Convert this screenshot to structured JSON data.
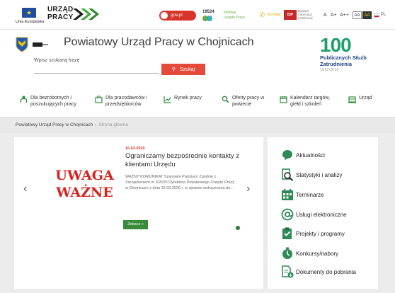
{
  "topbar": {
    "eu_label": "Unia Europejska",
    "urzad_line1": "URZĄD",
    "urzad_line2": "PRACY",
    "gov_label": "gov.pl",
    "contact_number": "19524",
    "contact_text_line1": "Infolinia",
    "contact_text_line2": "Urzędu Pracy",
    "contact_label": "Kontakt",
    "bip_label": "BIP",
    "bip_text": [
      "Biuletyn",
      "Informacji",
      "Publicznej"
    ],
    "font_sizes": [
      "A",
      "A+",
      "A++"
    ],
    "contrast": [
      "AA",
      "AA"
    ],
    "language": "PL"
  },
  "header": {
    "title": "Powiatowy Urząd Pracy w Chojnicach",
    "search_label": "Wpisz szukaną frazę",
    "search_placeholder": "",
    "search_button": "Szukaj",
    "anniversary": {
      "number": "100",
      "line1": "Publicznych Służb",
      "line2": "Zatrudnienia",
      "years": "1919-2019"
    }
  },
  "nav": {
    "items": [
      {
        "label_line1": "Dla bezrobotnych i",
        "label_line2": "poszukujących pracy",
        "icon": "person-icon"
      },
      {
        "label_line1": "Dla pracodawców i",
        "label_line2": "przedsiębiorców",
        "icon": "briefcase-icon"
      },
      {
        "label_line1": "Rynek pracy",
        "label_line2": "",
        "icon": "chart-icon"
      },
      {
        "label_line1": "Oferty pracy w",
        "label_line2": "powiecie",
        "icon": "search-icon"
      },
      {
        "label_line1": "Kalendarz targów,",
        "label_line2": "giełd i szkoleń",
        "icon": "calendar-icon"
      },
      {
        "label_line1": "Urząd",
        "label_line2": "",
        "icon": "building-icon"
      }
    ]
  },
  "breadcrumb": {
    "home": "Powiatowy Urząd Pracy w Chojnicach",
    "separator": "›",
    "current": "Strona główna"
  },
  "slider": {
    "image_text_line1": "UWAGA",
    "image_text_line2": "WAŻNE",
    "date": "16.03.2020",
    "title": "Ograniczamy bezpośrednie kontakty z klientami Urzędu",
    "body": "WAŻNY KOMUNIKAT Szanowni Państwo! Zgodnie z Zarządzeniem nr 3/2020 Dyrektora Powiatowego Urzędu Pracy w Chojnicach z dnia 16.03.2020 r. w sprawie wstrzymania do...",
    "more_button": "Zobacz »",
    "prev": "‹",
    "next": "›"
  },
  "quick_links": [
    {
      "label": "Aktualności",
      "icon": "news-icon"
    },
    {
      "label": "Statystyki i analizy",
      "icon": "statistics-icon"
    },
    {
      "label": "Terminarze",
      "icon": "calendar-icon"
    },
    {
      "label": "Usługi elektroniczne",
      "icon": "at-icon"
    },
    {
      "label": "Projekty i programy",
      "icon": "clipboard-icon"
    },
    {
      "label": "Konkursy/nabory",
      "icon": "timer-icon"
    },
    {
      "label": "Dokumenty do pobrania",
      "icon": "document-icon"
    }
  ],
  "colors": {
    "accent_red": "#e34a3a",
    "accent_green": "#3a8a3c",
    "headline_red": "#d8231f",
    "quick_link_green": "#2e8b57"
  }
}
